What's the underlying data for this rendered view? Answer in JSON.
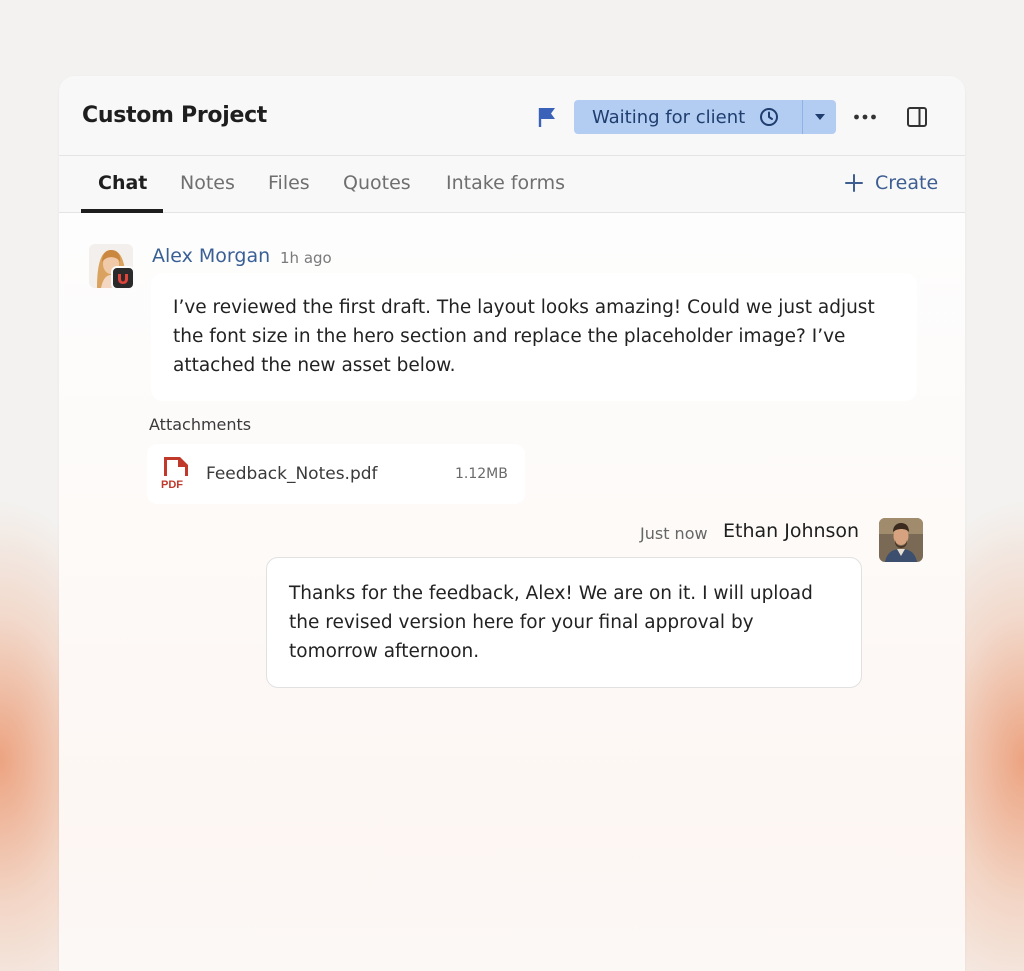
{
  "header": {
    "title": "Custom Project",
    "status_label": "Waiting for client",
    "status_color": "#b3cdf2",
    "flag_color": "#3a62b8",
    "icons": [
      "flag-icon",
      "clock-icon",
      "caret-down-icon",
      "more-horizontal-icon",
      "side-panel-icon"
    ]
  },
  "tabs": {
    "items": [
      {
        "label": "Chat",
        "active": true
      },
      {
        "label": "Notes",
        "active": false
      },
      {
        "label": "Files",
        "active": false
      },
      {
        "label": "Quotes",
        "active": false
      },
      {
        "label": "Intake forms",
        "active": false
      }
    ],
    "create_label": "Create"
  },
  "messages": [
    {
      "author": "Alex Morgan",
      "time": "1h ago",
      "text": "I’ve reviewed the first draft. The layout looks amazing! Could we just adjust the font size in the hero section and replace the placeholder image? I’ve attached the new asset below.",
      "attachments_label": "Attachments",
      "attachments": [
        {
          "name": "Feedback_Notes.pdf",
          "size": "1.12MB",
          "icon": "pdf-file-icon"
        }
      ]
    },
    {
      "author": "Ethan Johnson",
      "time": "Just now",
      "text": "Thanks for the feedback, Alex! We are on it. I will upload the revised version here for your final approval by tomorrow afternoon."
    }
  ]
}
